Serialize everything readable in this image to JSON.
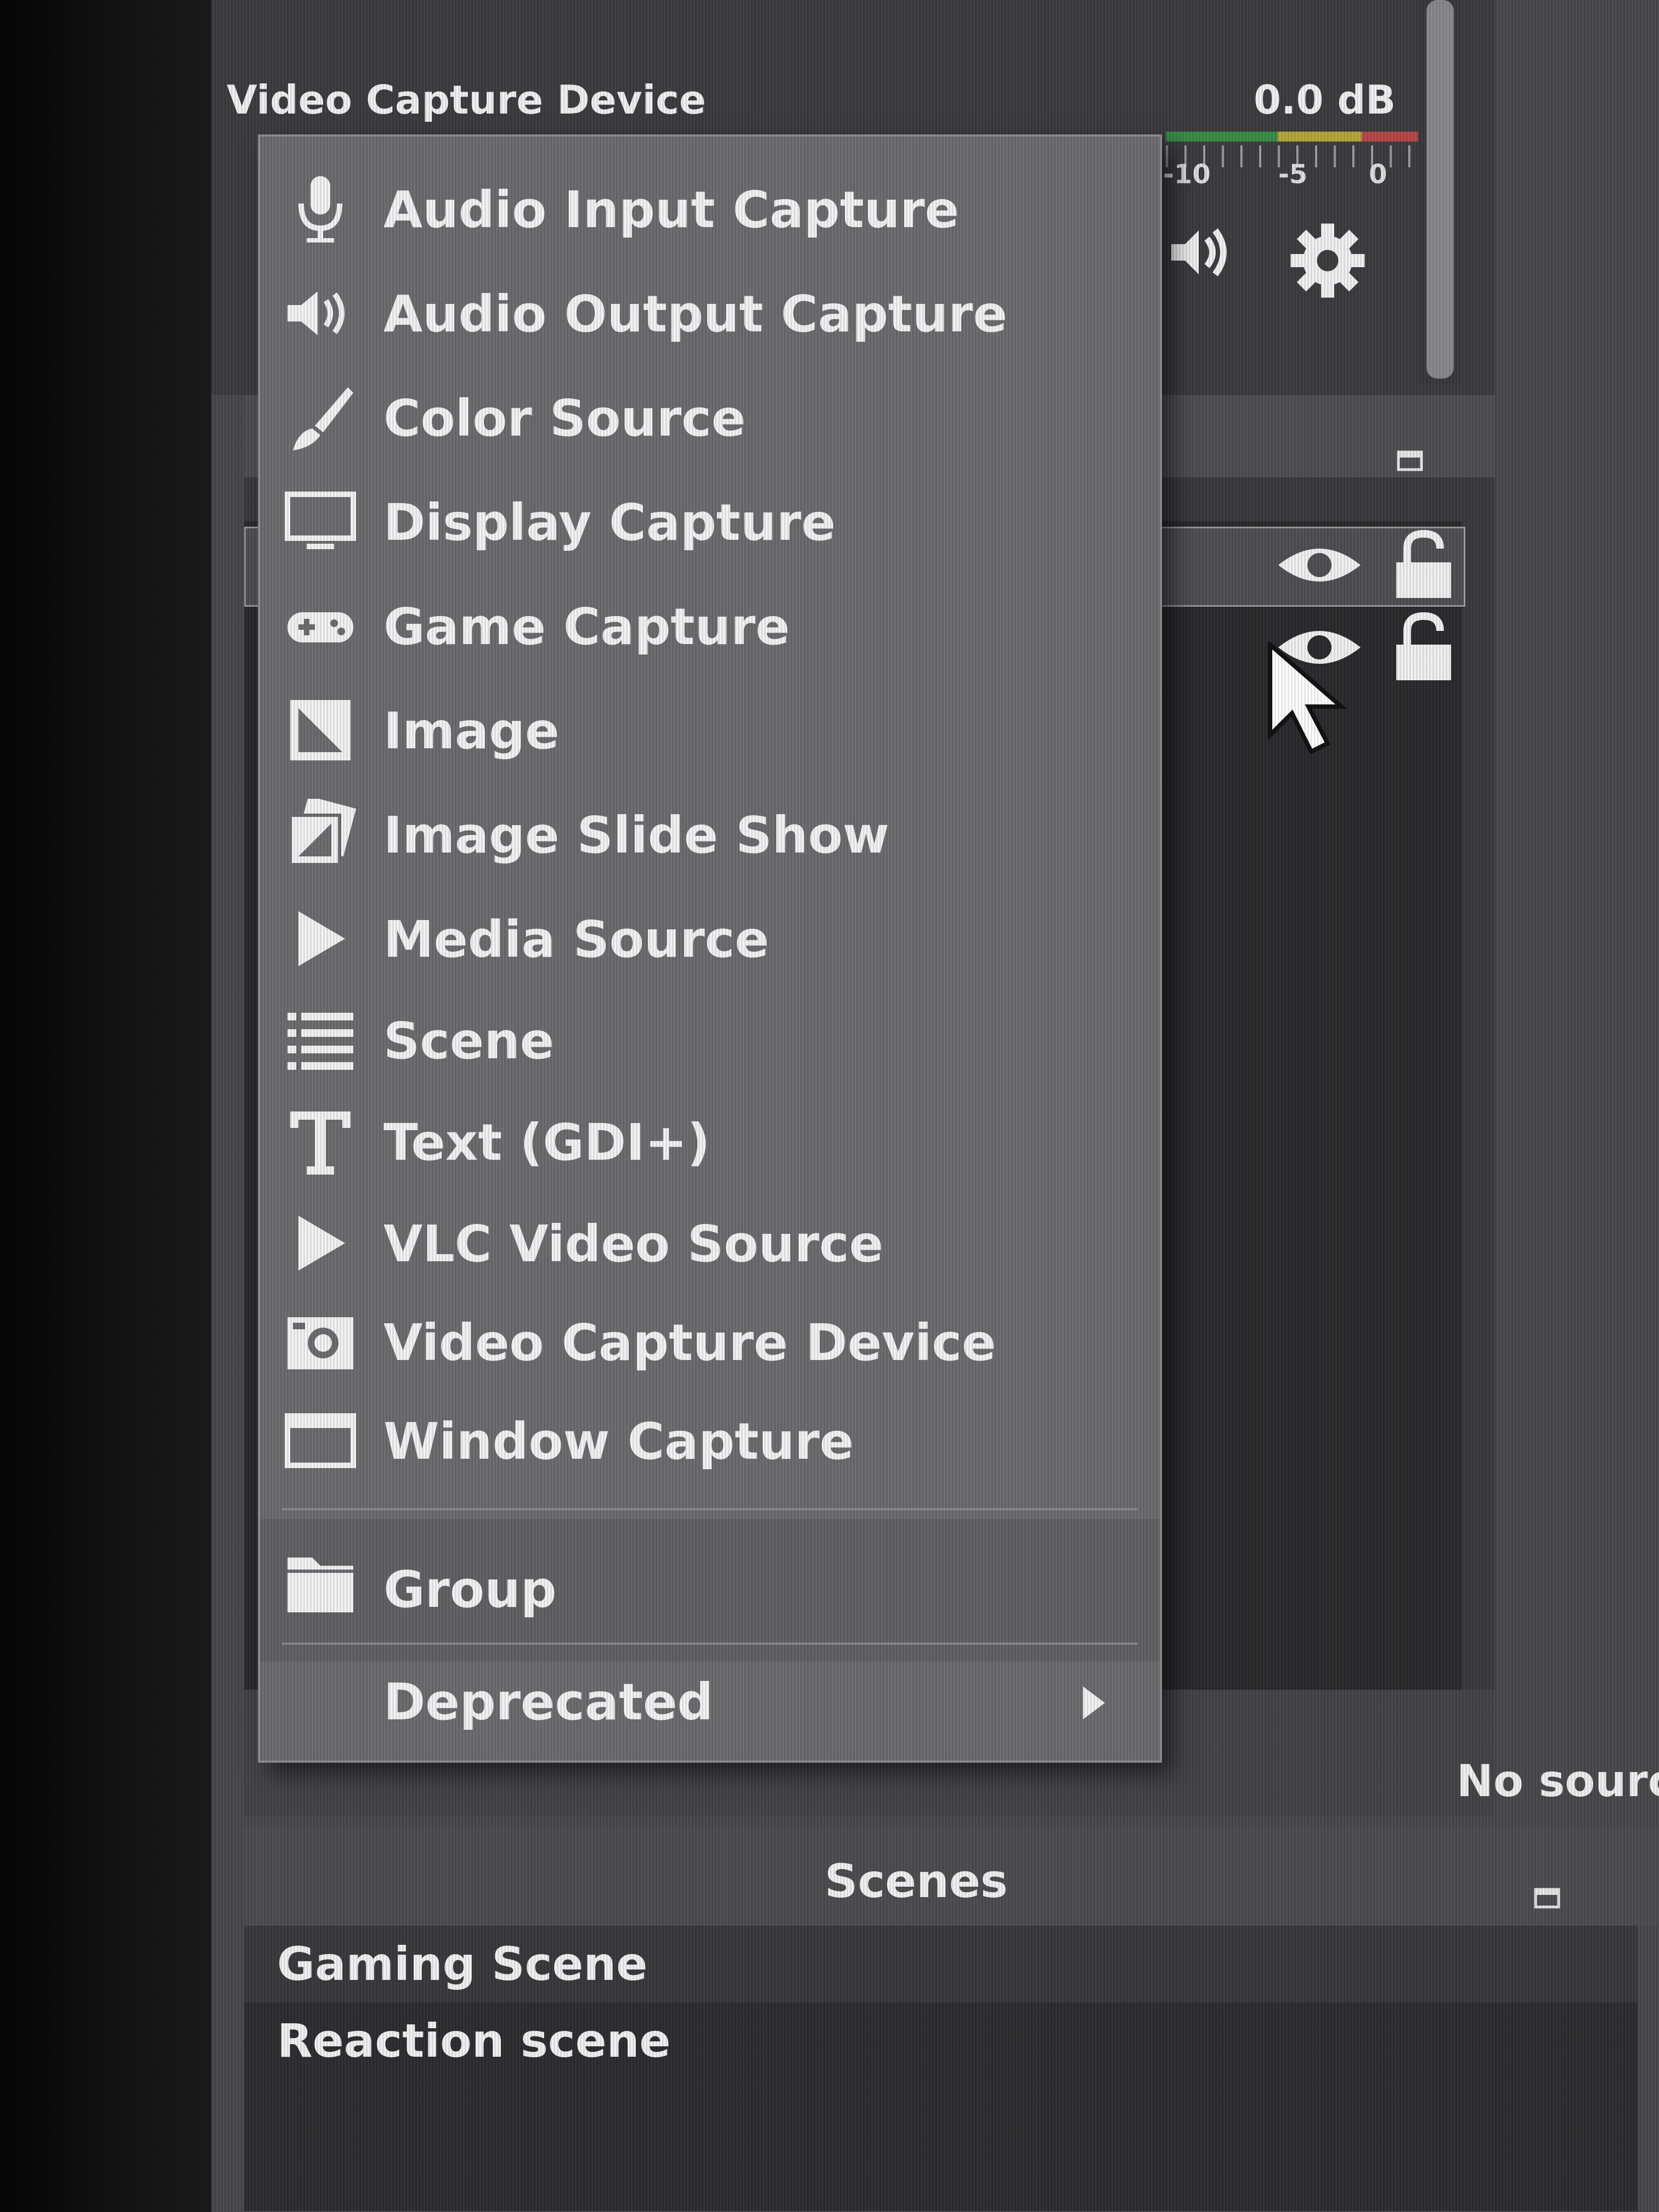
{
  "audio_mixer": {
    "source_name": "Video Capture Device",
    "db_value": "0.0 dB",
    "meter_ticks": [
      "-10",
      "-5",
      "0"
    ]
  },
  "context_menu": {
    "items": [
      {
        "label": "Audio Input Capture",
        "icon": "microphone-icon"
      },
      {
        "label": "Audio Output Capture",
        "icon": "speaker-icon"
      },
      {
        "label": "Color Source",
        "icon": "paintbrush-icon"
      },
      {
        "label": "Display Capture",
        "icon": "monitor-icon"
      },
      {
        "label": "Game Capture",
        "icon": "gamepad-icon"
      },
      {
        "label": "Image",
        "icon": "image-icon"
      },
      {
        "label": "Image Slide Show",
        "icon": "slideshow-icon"
      },
      {
        "label": "Media Source",
        "icon": "play-icon"
      },
      {
        "label": "Scene",
        "icon": "list-icon"
      },
      {
        "label": "Text (GDI+)",
        "icon": "text-icon"
      },
      {
        "label": "VLC Video Source",
        "icon": "play-icon"
      },
      {
        "label": "Video Capture Device",
        "icon": "camera-icon"
      },
      {
        "label": "Window Capture",
        "icon": "window-icon"
      }
    ],
    "group": {
      "label": "Group",
      "icon": "folder-icon"
    },
    "deprecated": {
      "label": "Deprecated",
      "icon": "chevron-right-icon"
    }
  },
  "sources_panel": {
    "empty_text": "No sourc"
  },
  "scenes_panel": {
    "title": "Scenes",
    "items": [
      "Gaming Scene",
      "Reaction scene"
    ]
  },
  "colors": {
    "menu_bg": "#6d6d70",
    "panel_bg": "#2b2b2d",
    "text": "#f4f4f4"
  }
}
